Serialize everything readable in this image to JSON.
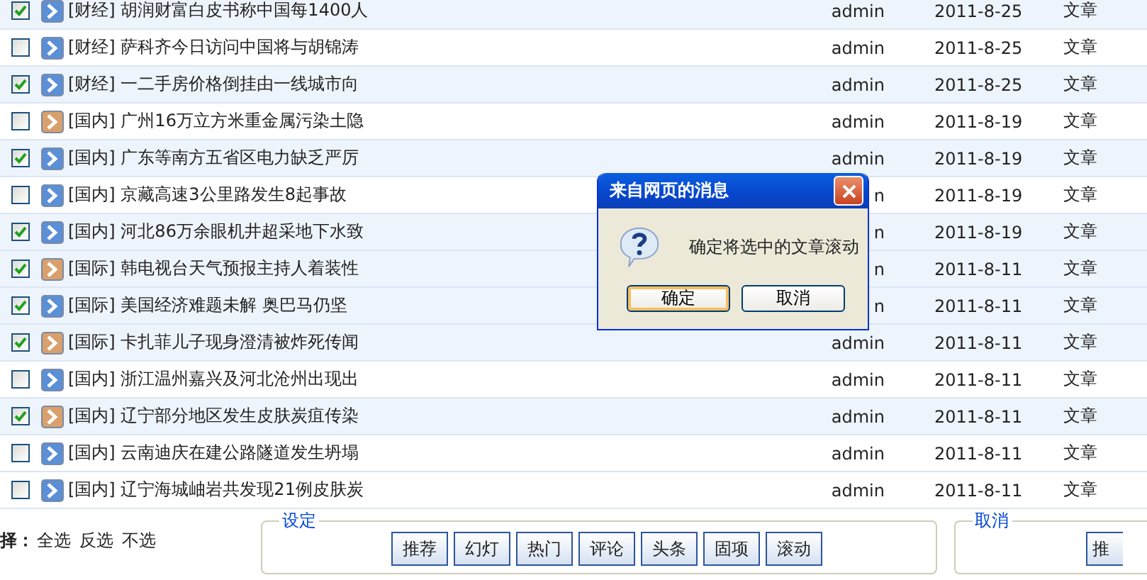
{
  "articles": [
    {
      "checked": true,
      "color": "#5b8fd6",
      "title": "[财经] 胡润财富白皮书称中国每1400人",
      "author": "admin",
      "date": "2011-8-25",
      "type": "文章"
    },
    {
      "checked": false,
      "color": "#5b8fd6",
      "title": "[财经] 萨科齐今日访问中国将与胡锦涛",
      "author": "admin",
      "date": "2011-8-25",
      "type": "文章"
    },
    {
      "checked": true,
      "color": "#5b8fd6",
      "title": "[财经] 一二手房价格倒挂由一线城市向",
      "author": "admin",
      "date": "2011-8-25",
      "type": "文章"
    },
    {
      "checked": false,
      "color": "#d9a06b",
      "title": "[国内] 广州16万立方米重金属污染土隐",
      "author": "admin",
      "date": "2011-8-19",
      "type": "文章"
    },
    {
      "checked": true,
      "color": "#5b8fd6",
      "title": "[国内] 广东等南方五省区电力缺乏严厉",
      "author": "admin",
      "date": "2011-8-19",
      "type": "文章"
    },
    {
      "checked": false,
      "color": "#5b8fd6",
      "title": "[国内] 京藏高速3公里路发生8起事故",
      "author": "n",
      "date": "2011-8-19",
      "type": "文章"
    },
    {
      "checked": true,
      "color": "#5b8fd6",
      "title": "[国内] 河北86万余眼机井超采地下水致",
      "author": "n",
      "date": "2011-8-19",
      "type": "文章"
    },
    {
      "checked": true,
      "color": "#d9a06b",
      "title": "[国际] 韩电视台天气预报主持人着装性",
      "author": "n",
      "date": "2011-8-11",
      "type": "文章"
    },
    {
      "checked": true,
      "color": "#5b8fd6",
      "title": "[国际] 美国经济难题未解 奥巴马仍坚",
      "author": "n",
      "date": "2011-8-11",
      "type": "文章"
    },
    {
      "checked": true,
      "color": "#d9a06b",
      "title": "[国际] 卡扎菲儿子现身澄清被炸死传闻",
      "author": "admin",
      "date": "2011-8-11",
      "type": "文章"
    },
    {
      "checked": false,
      "color": "#5b8fd6",
      "title": "[国内] 浙江温州嘉兴及河北沧州出现出",
      "author": "admin",
      "date": "2011-8-11",
      "type": "文章"
    },
    {
      "checked": true,
      "color": "#d9a06b",
      "title": "[国内] 辽宁部分地区发生皮肤炭疽传染",
      "author": "admin",
      "date": "2011-8-11",
      "type": "文章"
    },
    {
      "checked": false,
      "color": "#5b8fd6",
      "title": "[国内] 云南迪庆在建公路隧道发生坍塌",
      "author": "admin",
      "date": "2011-8-11",
      "type": "文章"
    },
    {
      "checked": false,
      "color": "#5b8fd6",
      "title": "[国内] 辽宁海城岫岩共发现21例皮肤炭",
      "author": "admin",
      "date": "2011-8-11",
      "type": "文章"
    }
  ],
  "selection": {
    "label": "择：",
    "options": [
      "全选",
      "反选",
      "不选"
    ]
  },
  "set_group": {
    "legend": "设定",
    "buttons": [
      "推荐",
      "幻灯",
      "热门",
      "评论",
      "头条",
      "固项",
      "滚动"
    ]
  },
  "cancel_group": {
    "legend": "取消",
    "buttons": [
      "推"
    ]
  },
  "dialog": {
    "title": "来自网页的消息",
    "message": "确定将选中的文章滚动",
    "buttons": [
      {
        "label": "确定",
        "selected": true
      },
      {
        "label": "取消",
        "selected": false
      }
    ]
  }
}
